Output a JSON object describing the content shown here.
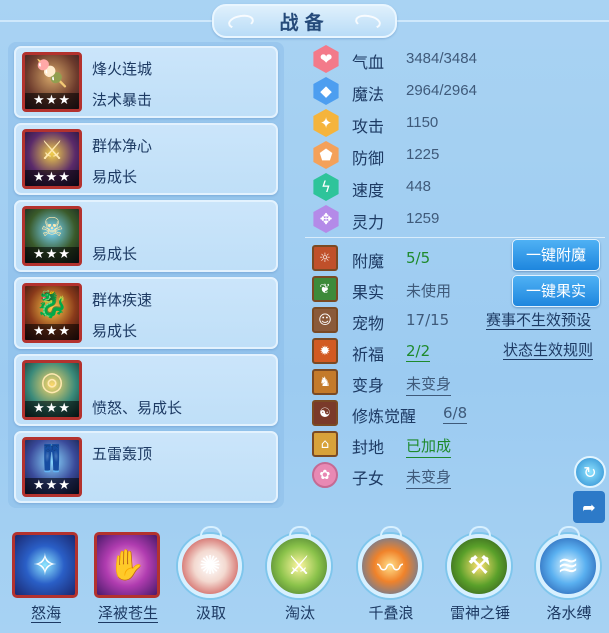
{
  "title": "战备",
  "equipment": [
    {
      "name": "烽火连城",
      "attr": "法术暴击",
      "stars": "★★★",
      "glyph": "🍡"
    },
    {
      "name": "群体净心",
      "attr": "易成长",
      "stars": "★★★",
      "glyph": "⚔"
    },
    {
      "name": "",
      "attr": "易成长",
      "stars": "★★★",
      "glyph": "☠"
    },
    {
      "name": "群体疾速",
      "attr": "易成长",
      "stars": "★★★",
      "glyph": "🐉"
    },
    {
      "name": "",
      "attr": "愤怒、易成长",
      "stars": "★★★",
      "glyph": "◎"
    },
    {
      "name": "五雷轰顶",
      "attr": "",
      "stars": "★★★",
      "glyph": "👖"
    }
  ],
  "stats": [
    {
      "label": "气血",
      "value": "3484/3484",
      "icon": "heart-icon",
      "glyph": "❤",
      "color": "#f37a8a"
    },
    {
      "label": "魔法",
      "value": "2964/2964",
      "icon": "mana-icon",
      "glyph": "◆",
      "color": "#4d9ef0"
    },
    {
      "label": "攻击",
      "value": "1150",
      "icon": "sword-icon",
      "glyph": "✦",
      "color": "#f5b43c"
    },
    {
      "label": "防御",
      "value": "1225",
      "icon": "shield-icon",
      "glyph": "⬟",
      "color": "#f4a15a"
    },
    {
      "label": "速度",
      "value": "448",
      "icon": "speed-icon",
      "glyph": "ϟ",
      "color": "#2ec49a"
    },
    {
      "label": "灵力",
      "value": "1259",
      "icon": "spirit-icon",
      "glyph": "✥",
      "color": "#b48ae8"
    }
  ],
  "functions": [
    {
      "label": "附魔",
      "value": "5/5",
      "green": true,
      "underline": false,
      "icon": "enchant-icon",
      "glyph": "☼",
      "bg": "#c0502a"
    },
    {
      "label": "果实",
      "value": "未使用",
      "green": false,
      "underline": false,
      "icon": "fruit-icon",
      "glyph": "❦",
      "bg": "#3d8a3a"
    },
    {
      "label": "宠物",
      "value": "17/15",
      "green": false,
      "underline": false,
      "icon": "pet-icon",
      "glyph": "☺",
      "bg": "#8a5a3a"
    },
    {
      "label": "祈福",
      "value": "2/2",
      "green": true,
      "underline": true,
      "icon": "blessing-icon",
      "glyph": "✹",
      "bg": "#d25a22"
    },
    {
      "label": "变身",
      "value": "未变身",
      "green": false,
      "underline": true,
      "icon": "transform-icon",
      "glyph": "♞",
      "bg": "#c47a2a"
    },
    {
      "label": "修炼觉醒",
      "value": "6/8",
      "green": false,
      "underline": true,
      "icon": "cultivation-icon",
      "glyph": "☯",
      "bg": "#7a3a2a"
    },
    {
      "label": "封地",
      "value": "已加成",
      "green": true,
      "underline": true,
      "icon": "fief-icon",
      "glyph": "⌂",
      "bg": "#d8a23a"
    },
    {
      "label": "子女",
      "value": "未变身",
      "green": false,
      "underline": true,
      "icon": "child-icon",
      "glyph": "✿",
      "bg": "#e889b4"
    }
  ],
  "buttons": {
    "enchant_all": "一键附魔",
    "fruit_all": "一键果实"
  },
  "links": {
    "event_preset": "赛事不生效预设",
    "status_rules": "状态生效规则"
  },
  "skills": [
    {
      "name": "怒海",
      "underline": true,
      "style": "square",
      "glyph": "✧",
      "bg": "radial-gradient(circle, #8fe7ff 0%, #2a5fc7 45%, #1a2870 100%)"
    },
    {
      "name": "泽被苍生",
      "underline": true,
      "style": "square",
      "glyph": "✋",
      "bg": "radial-gradient(circle, #ffb0e0 0%, #b03cb0 50%, #4a1a6a 100%)"
    },
    {
      "name": "汲取",
      "underline": false,
      "style": "round",
      "glyph": "✺",
      "bg": "radial-gradient(circle, #ffffff 0%, #f3d9d0 40%, #c02a2a 100%)"
    },
    {
      "name": "淘汰",
      "underline": false,
      "style": "round",
      "glyph": "⚔",
      "bg": "radial-gradient(circle, #fff6a0 0%, #8ac24a 50%, #3a6a2a 100%)"
    },
    {
      "name": "千叠浪",
      "underline": false,
      "style": "round",
      "glyph": "〰",
      "bg": "radial-gradient(circle, #ffe08a 0%, #f0822a 40%, #2a7ad0 100%)"
    },
    {
      "name": "雷神之锤",
      "underline": false,
      "style": "round",
      "glyph": "⚒",
      "bg": "radial-gradient(circle, #ffe070 0%, #5aa02a 50%, #2a4a1a 100%)"
    },
    {
      "name": "洛水缚",
      "underline": false,
      "style": "round",
      "glyph": "≋",
      "bg": "radial-gradient(circle, #e0f6ff 0%, #5ab0f0 45%, #1a4aa0 100%)"
    }
  ]
}
